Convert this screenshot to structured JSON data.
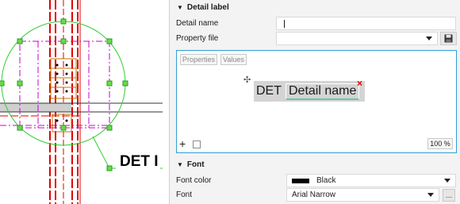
{
  "canvas": {
    "det_label": "DET I"
  },
  "panel": {
    "detail_label_section": {
      "title": "Detail label",
      "detail_name": {
        "label": "Detail name",
        "value": ""
      },
      "property_file": {
        "label": "Property file",
        "value": ""
      },
      "editor": {
        "tab_properties": "Properties",
        "tab_values": "Values",
        "preview_prefix": "DET",
        "preview_name": "Detail name",
        "zoom": "100 %"
      }
    },
    "font_section": {
      "title": "Font",
      "font_color": {
        "label": "Font color",
        "value": "Black",
        "swatch": "#000000"
      },
      "font": {
        "label": "Font",
        "value": "Arial Narrow"
      }
    }
  },
  "colors": {
    "detail_circle": "#33cc33",
    "rebar_red": "#e00000",
    "magenta_dash": "#cc00cc",
    "accent_border": "#2fa0d6"
  }
}
